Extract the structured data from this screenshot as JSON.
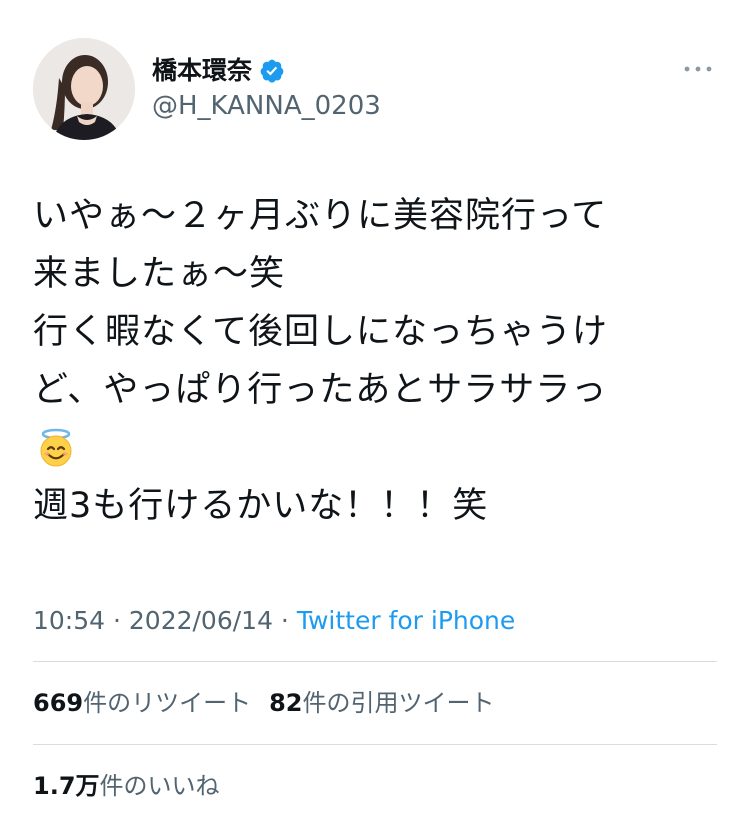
{
  "profile": {
    "display_name": "橋本環奈",
    "handle": "@H_KANNA_0203",
    "avatar_icon": "profile-photo",
    "verified_icon": "verified-badge-icon",
    "verified_color": "#1d9bf0"
  },
  "tweet": {
    "lines": [
      "いやぁ〜２ヶ月ぶりに美容院行って",
      "来ましたぁ〜笑",
      "行く暇なくて後回しになっちゃうけ",
      "ど、やっぱり行ったあとサラサラっ"
    ],
    "emoji_icon": "smiling-face-with-halo-emoji",
    "last_line": "週3も行けるかいな！！！笑"
  },
  "meta": {
    "time": "10:54",
    "date": "2022/06/14",
    "separator": " · ",
    "source": "Twitter for iPhone"
  },
  "stats": {
    "retweets_count": "669",
    "retweets_label": "件のリツイート",
    "quotes_count": "82",
    "quotes_label": "件の引用ツイート",
    "likes_count": "1.7万",
    "likes_label": "件のいいね"
  },
  "colors": {
    "text": "#0f1419",
    "secondary": "#536471",
    "link": "#1d9bf0",
    "divider": "#d9dde1"
  }
}
